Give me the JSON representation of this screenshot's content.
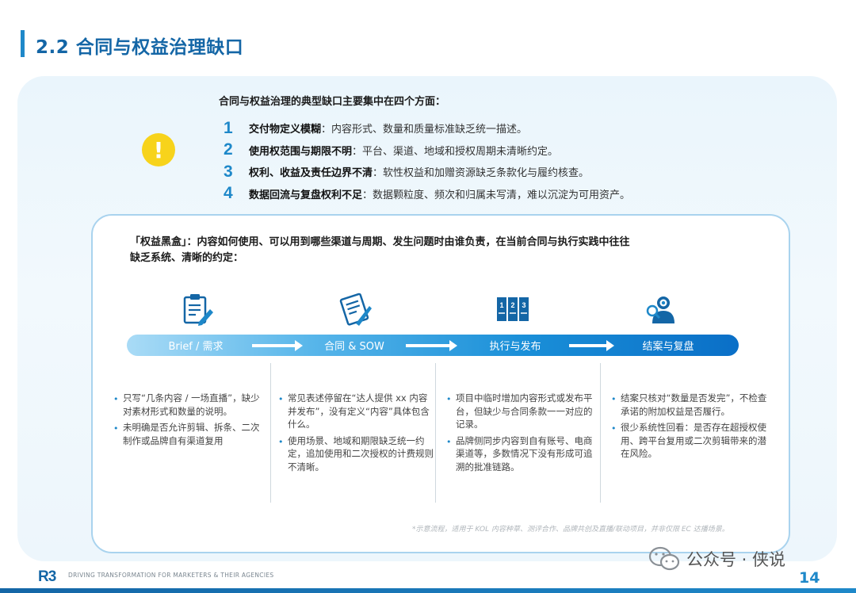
{
  "header": {
    "title": "2.2 合同与权益治理缺口"
  },
  "intro": "合同与权益治理的典型缺口主要集中在四个方面：",
  "warning_icon": {
    "glyph": "!",
    "color": "#F7D31B"
  },
  "points": [
    {
      "num": "1",
      "head": "交付物定义模糊",
      "body": "：内容形式、数量和质量标准缺乏统一描述。"
    },
    {
      "num": "2",
      "head": "使用权范围与期限不明",
      "body": "：平台、渠道、地域和授权周期未清晰约定。"
    },
    {
      "num": "3",
      "head": "权利、收益及责任边界不清",
      "body": "：软性权益和加赠资源缺乏条款化与履约核查。"
    },
    {
      "num": "4",
      "head": "数据回流与复盘权利不足",
      "body": "：数据颗粒度、频次和归属未写清，难以沉淀为可用资产。"
    }
  ],
  "blackbox": {
    "line1": "「权益黑盒」：内容如何使用、可以用到哪些渠道与周期、发生问题时由谁负责，在当前合同与执行实践中往往",
    "line2": "缺乏系统、清晰的约定："
  },
  "stages": [
    {
      "label": "Brief / 需求",
      "icon": "clipboard-icon"
    },
    {
      "label": "合同 & SOW",
      "icon": "contract-icon"
    },
    {
      "label": "执行与发布",
      "icon": "numbered-steps-icon"
    },
    {
      "label": "结案与复盘",
      "icon": "review-person-icon"
    }
  ],
  "columns": [
    [
      "只写“几条内容 / 一场直播”，缺少对素材形式和数量的说明。",
      "未明确是否允许剪辑、拆条、二次制作或品牌自有渠道复用"
    ],
    [
      "常见表述停留在“达人提供 xx 内容并发布”，没有定义“内容”具体包含什么。",
      "使用场景、地域和期限缺乏统一约定，追加使用和二次授权的计费规则不清晰。"
    ],
    [
      "项目中临时增加内容形式或发布平台，但缺少与合同条款一一对应的记录。",
      "品牌侧同步内容到自有账号、电商渠道等，多数情况下没有形成可追溯的批准链路。"
    ],
    [
      "结案只核对“数量是否发完”，不检查承诺的附加权益是否履行。",
      "很少系统性回看：是否存在超授权使用、跨平台复用或二次剪辑带来的潜在风险。"
    ]
  ],
  "footnote": "*示意流程，适用于 KOL 内容种草、测评合作、品牌共创及直播/联动项目，并非仅限 EC 达播场景。",
  "footer": {
    "logo": "R3",
    "tagline": "DRIVING TRANSFORMATION FOR MARKETERS & THEIR AGENCIES",
    "wechat": "公众号 · 侠说",
    "page": "14"
  },
  "colors": {
    "accent": "#1E88C9",
    "title": "#1466A6",
    "warning": "#F7D31B"
  }
}
